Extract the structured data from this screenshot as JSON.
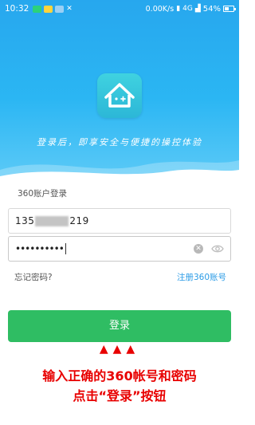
{
  "status_bar": {
    "time": "10:32",
    "speed": "0.00K/s",
    "network": "4G",
    "battery": "54%",
    "battery_level": 0.54
  },
  "hero": {
    "slogan": "登录后，即享安全与便捷的操控体验",
    "colors": {
      "top": "#27a7ee",
      "bottom": "#5ccaf7"
    }
  },
  "login": {
    "section_label": "360账户登录",
    "phone_prefix": "135",
    "phone_suffix": "219",
    "password_dots": "••••••••••",
    "forgot_link": "忘记密码?",
    "register_link": "注册360账号",
    "submit_label": "登录",
    "icons": [
      "clear-icon",
      "eye-icon"
    ]
  },
  "annotation": {
    "arrows": "▲▲▲",
    "line1": "输入正确的360帐号和密码",
    "line2": "点击“登录”按钮",
    "color": "#e80000"
  },
  "accent_colors": {
    "button": "#2fbd63",
    "link": "#2a9be6"
  }
}
